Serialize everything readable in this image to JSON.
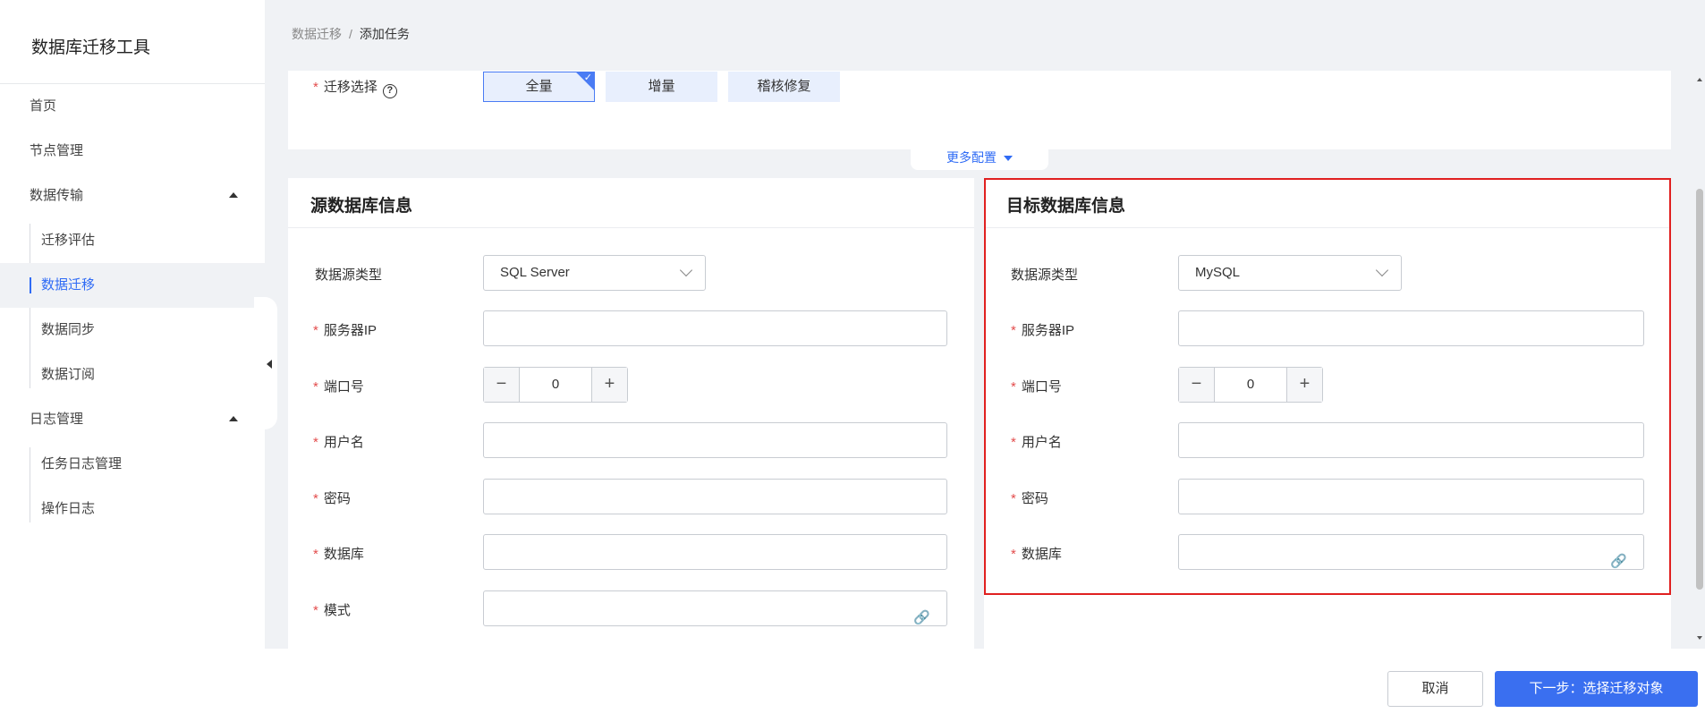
{
  "app": {
    "title": "数据库迁移工具"
  },
  "sidebar": {
    "items": [
      {
        "label": "首页"
      },
      {
        "label": "节点管理"
      },
      {
        "label": "数据传输"
      },
      {
        "label": "迁移评估"
      },
      {
        "label": "数据迁移"
      },
      {
        "label": "数据同步"
      },
      {
        "label": "数据订阅"
      },
      {
        "label": "日志管理"
      },
      {
        "label": "任务日志管理"
      },
      {
        "label": "操作日志"
      }
    ]
  },
  "breadcrumb": {
    "parent": "数据迁移",
    "separator": "/",
    "current": "添加任务"
  },
  "migration": {
    "label": "迁移选择",
    "options": [
      {
        "label": "全量"
      },
      {
        "label": "增量"
      },
      {
        "label": "稽核修复"
      }
    ],
    "selected": "全量",
    "more_config": "更多配置"
  },
  "source": {
    "title": "源数据库信息",
    "fields": {
      "type_label": "数据源类型",
      "type_value": "SQL Server",
      "ip_label": "服务器IP",
      "ip_value": "",
      "port_label": "端口号",
      "port_value": "0",
      "user_label": "用户名",
      "user_value": "",
      "password_label": "密码",
      "password_value": "",
      "database_label": "数据库",
      "database_value": "",
      "schema_label": "模式",
      "schema_value": ""
    }
  },
  "target": {
    "title": "目标数据库信息",
    "fields": {
      "type_label": "数据源类型",
      "type_value": "MySQL",
      "ip_label": "服务器IP",
      "ip_value": "",
      "port_label": "端口号",
      "port_value": "0",
      "user_label": "用户名",
      "user_value": "",
      "password_label": "密码",
      "password_value": "",
      "database_label": "数据库",
      "database_value": ""
    }
  },
  "footer": {
    "cancel": "取消",
    "next": "下一步：选择迁移对象"
  },
  "symbols": {
    "required": "*",
    "help": "?",
    "minus": "−",
    "plus": "+",
    "link": "🔗",
    "check": "✓"
  },
  "colors": {
    "accent": "#3a6ff0",
    "highlight": "#e02020",
    "required": "#e34d4d"
  }
}
